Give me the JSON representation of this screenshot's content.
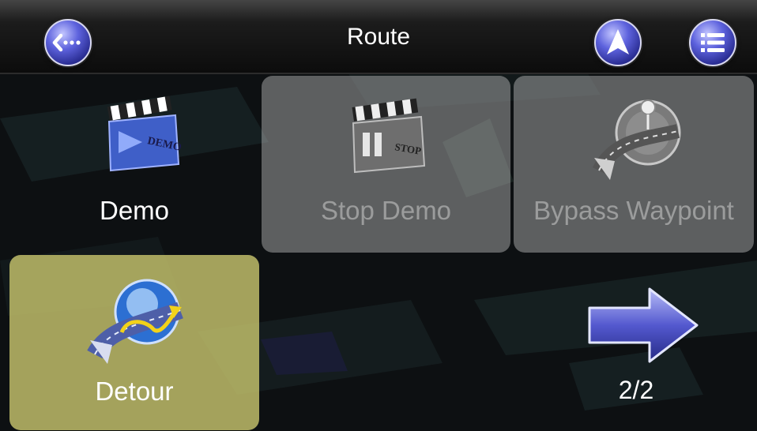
{
  "header": {
    "title": "Route",
    "back_icon": "back-more-icon",
    "navigation_icon": "navigation-arrow-icon",
    "menu_icon": "list-menu-icon"
  },
  "menu": {
    "demo": {
      "label": "Demo",
      "icon": "demo-clapperboard-icon",
      "enabled": true
    },
    "stop_demo": {
      "label": "Stop Demo",
      "icon": "stop-clapperboard-icon",
      "enabled": false
    },
    "bypass_waypoint": {
      "label": "Bypass Waypoint",
      "icon": "bypass-waypoint-icon",
      "enabled": false
    },
    "detour": {
      "label": "Detour",
      "icon": "detour-road-icon",
      "selected": true
    }
  },
  "pager": {
    "page": "2/2",
    "icon": "next-page-arrow-icon"
  },
  "colors": {
    "accent": "#5a5fd6",
    "selected_tile": "#c6c36c",
    "disabled_tile": "#cdcdcd"
  }
}
